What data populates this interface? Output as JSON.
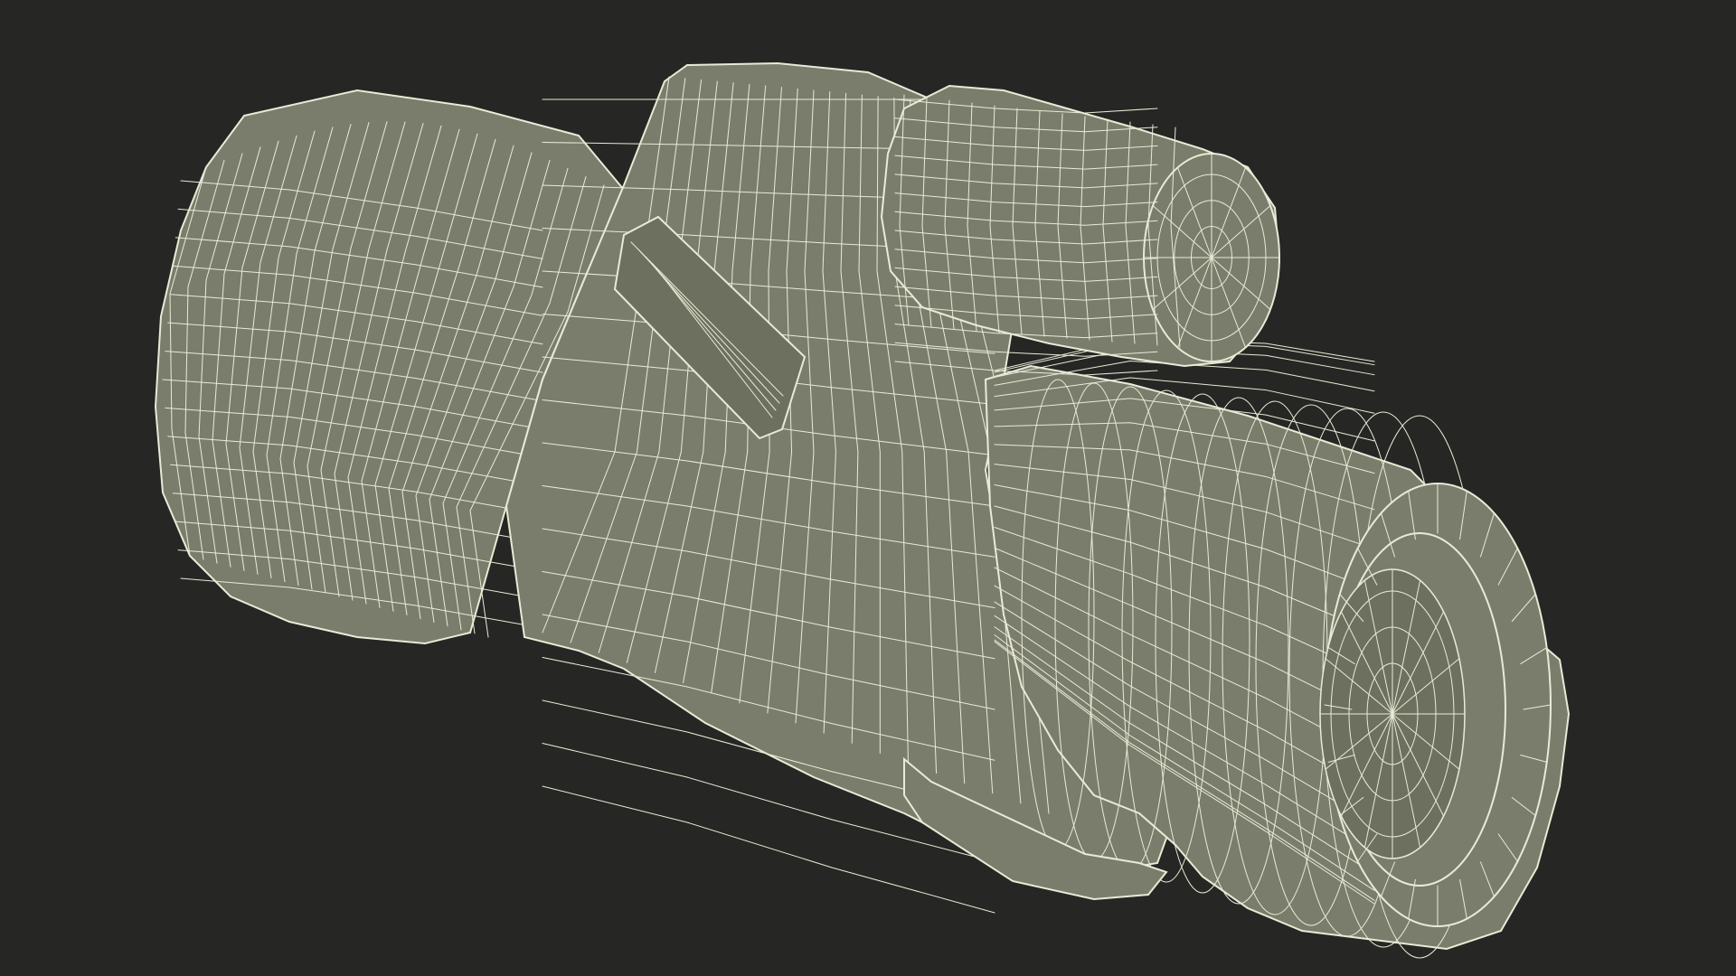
{
  "scene": {
    "subject": "monocular",
    "render_style": "wireframe",
    "colors": {
      "background": "#262624",
      "surface": "#7b7d6c",
      "surface_shade": "#6e705f",
      "wire": "#e9ead6",
      "wire_dim": "#d6d8c0"
    }
  }
}
